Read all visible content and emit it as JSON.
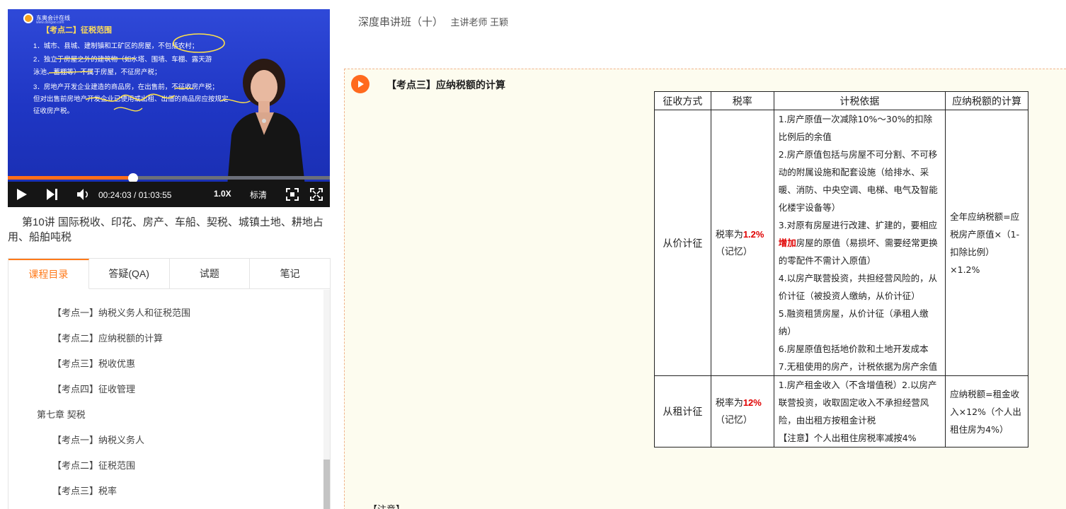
{
  "video": {
    "slide": {
      "brand": "东奥会计在线",
      "brand_sub": "www.dongao.com",
      "title": "【考点二】征税范围",
      "lines": [
        "1．城市、县城、建制镇和工矿区的房屋，不包括农村；",
        "2．独立于房屋之外的建筑物（如水塔、围墙、车棚、露天游",
        "泳池、蓄棚等）不属于房屋，不征房产税；",
        "3．房地产开发企业建造的商品房，在出售前，不征收房产税；",
        "但对出售前房地产开发企业已使用或出租、出借的商品房应按规定",
        "征收房产税。"
      ]
    },
    "progress_fraction": 0.388,
    "time": "00:24:03 / 01:03:55",
    "speed": "1.0X",
    "quality": "标清",
    "icons": [
      "play-icon",
      "next-icon",
      "volume-icon",
      "fit-screen-icon",
      "fullscreen-icon"
    ]
  },
  "lesson": {
    "title": "第10讲 国际税收、印花、房产、车船、契税、城镇土地、耕地占用、船舶吨税"
  },
  "tabs": [
    {
      "label": "课程目录",
      "active": true
    },
    {
      "label": "答疑(QA)",
      "active": false
    },
    {
      "label": "试题",
      "active": false
    },
    {
      "label": "笔记",
      "active": false
    }
  ],
  "catalog": [
    {
      "label": "【考点一】纳税义务人和征税范围",
      "type": "sub"
    },
    {
      "label": "【考点二】应纳税额的计算",
      "type": "sub"
    },
    {
      "label": "【考点三】税收优惠",
      "type": "sub"
    },
    {
      "label": "【考点四】征收管理",
      "type": "sub"
    },
    {
      "label": "第七章 契税",
      "type": "chap"
    },
    {
      "label": "【考点一】纳税义务人",
      "type": "sub"
    },
    {
      "label": "【考点二】征税范围",
      "type": "sub"
    },
    {
      "label": "【考点三】税率",
      "type": "sub"
    }
  ],
  "header": {
    "course": "深度串讲班（十）",
    "teacher": "主讲老师 王颖"
  },
  "section": {
    "title": "【考点三】应纳税额的计算",
    "attention": "【注意】"
  },
  "table": {
    "headers": [
      "征收方式",
      "税率",
      "计税依据",
      "应纳税额的计算"
    ],
    "rows": [
      {
        "method": "从价计征",
        "rate_prefix": "税率为",
        "rate_value": "1.2%",
        "rate_suffix": "（记忆）",
        "basis": [
          "1.房产原值一次减除10%～30%的扣除比例后的余值",
          "2.房产原值包括与房屋不可分割、不可移动的附属设施和配套设施（给排水、采暖、消防、中央空调、电梯、电气及智能化楼宇设备等）",
          "3.对原有房屋进行改建、扩建的，要相应",
          "增加",
          "房屋的原值（易损坏、需要经常更换的零配件不需计入原值）",
          "4.以房产联营投资，共担经营风险的，从价计征（被投资人缴纳，从价计征）",
          "5.融资租赁房屋，从价计征（承租人缴纳）",
          "6.房屋原值包括地价款和土地开发成本",
          "7.无租使用的房产，计税依据为房产余值"
        ],
        "calc": "全年应纳税额=应税房产原值×（1-扣除比例）×1.2%"
      },
      {
        "method": "从租计征",
        "rate_prefix": "税率为",
        "rate_value": "12%",
        "rate_suffix": "（记忆）",
        "basis": [
          "1.房产租金收入（不含增值税）2.以房产联营投资，收取固定收入不承担经营风险，由出租方按租金计税",
          "【注意】个人出租住房税率减按4%"
        ],
        "calc": "应纳税额=租金收入×12%（个人出租住房为4%）"
      }
    ]
  }
}
